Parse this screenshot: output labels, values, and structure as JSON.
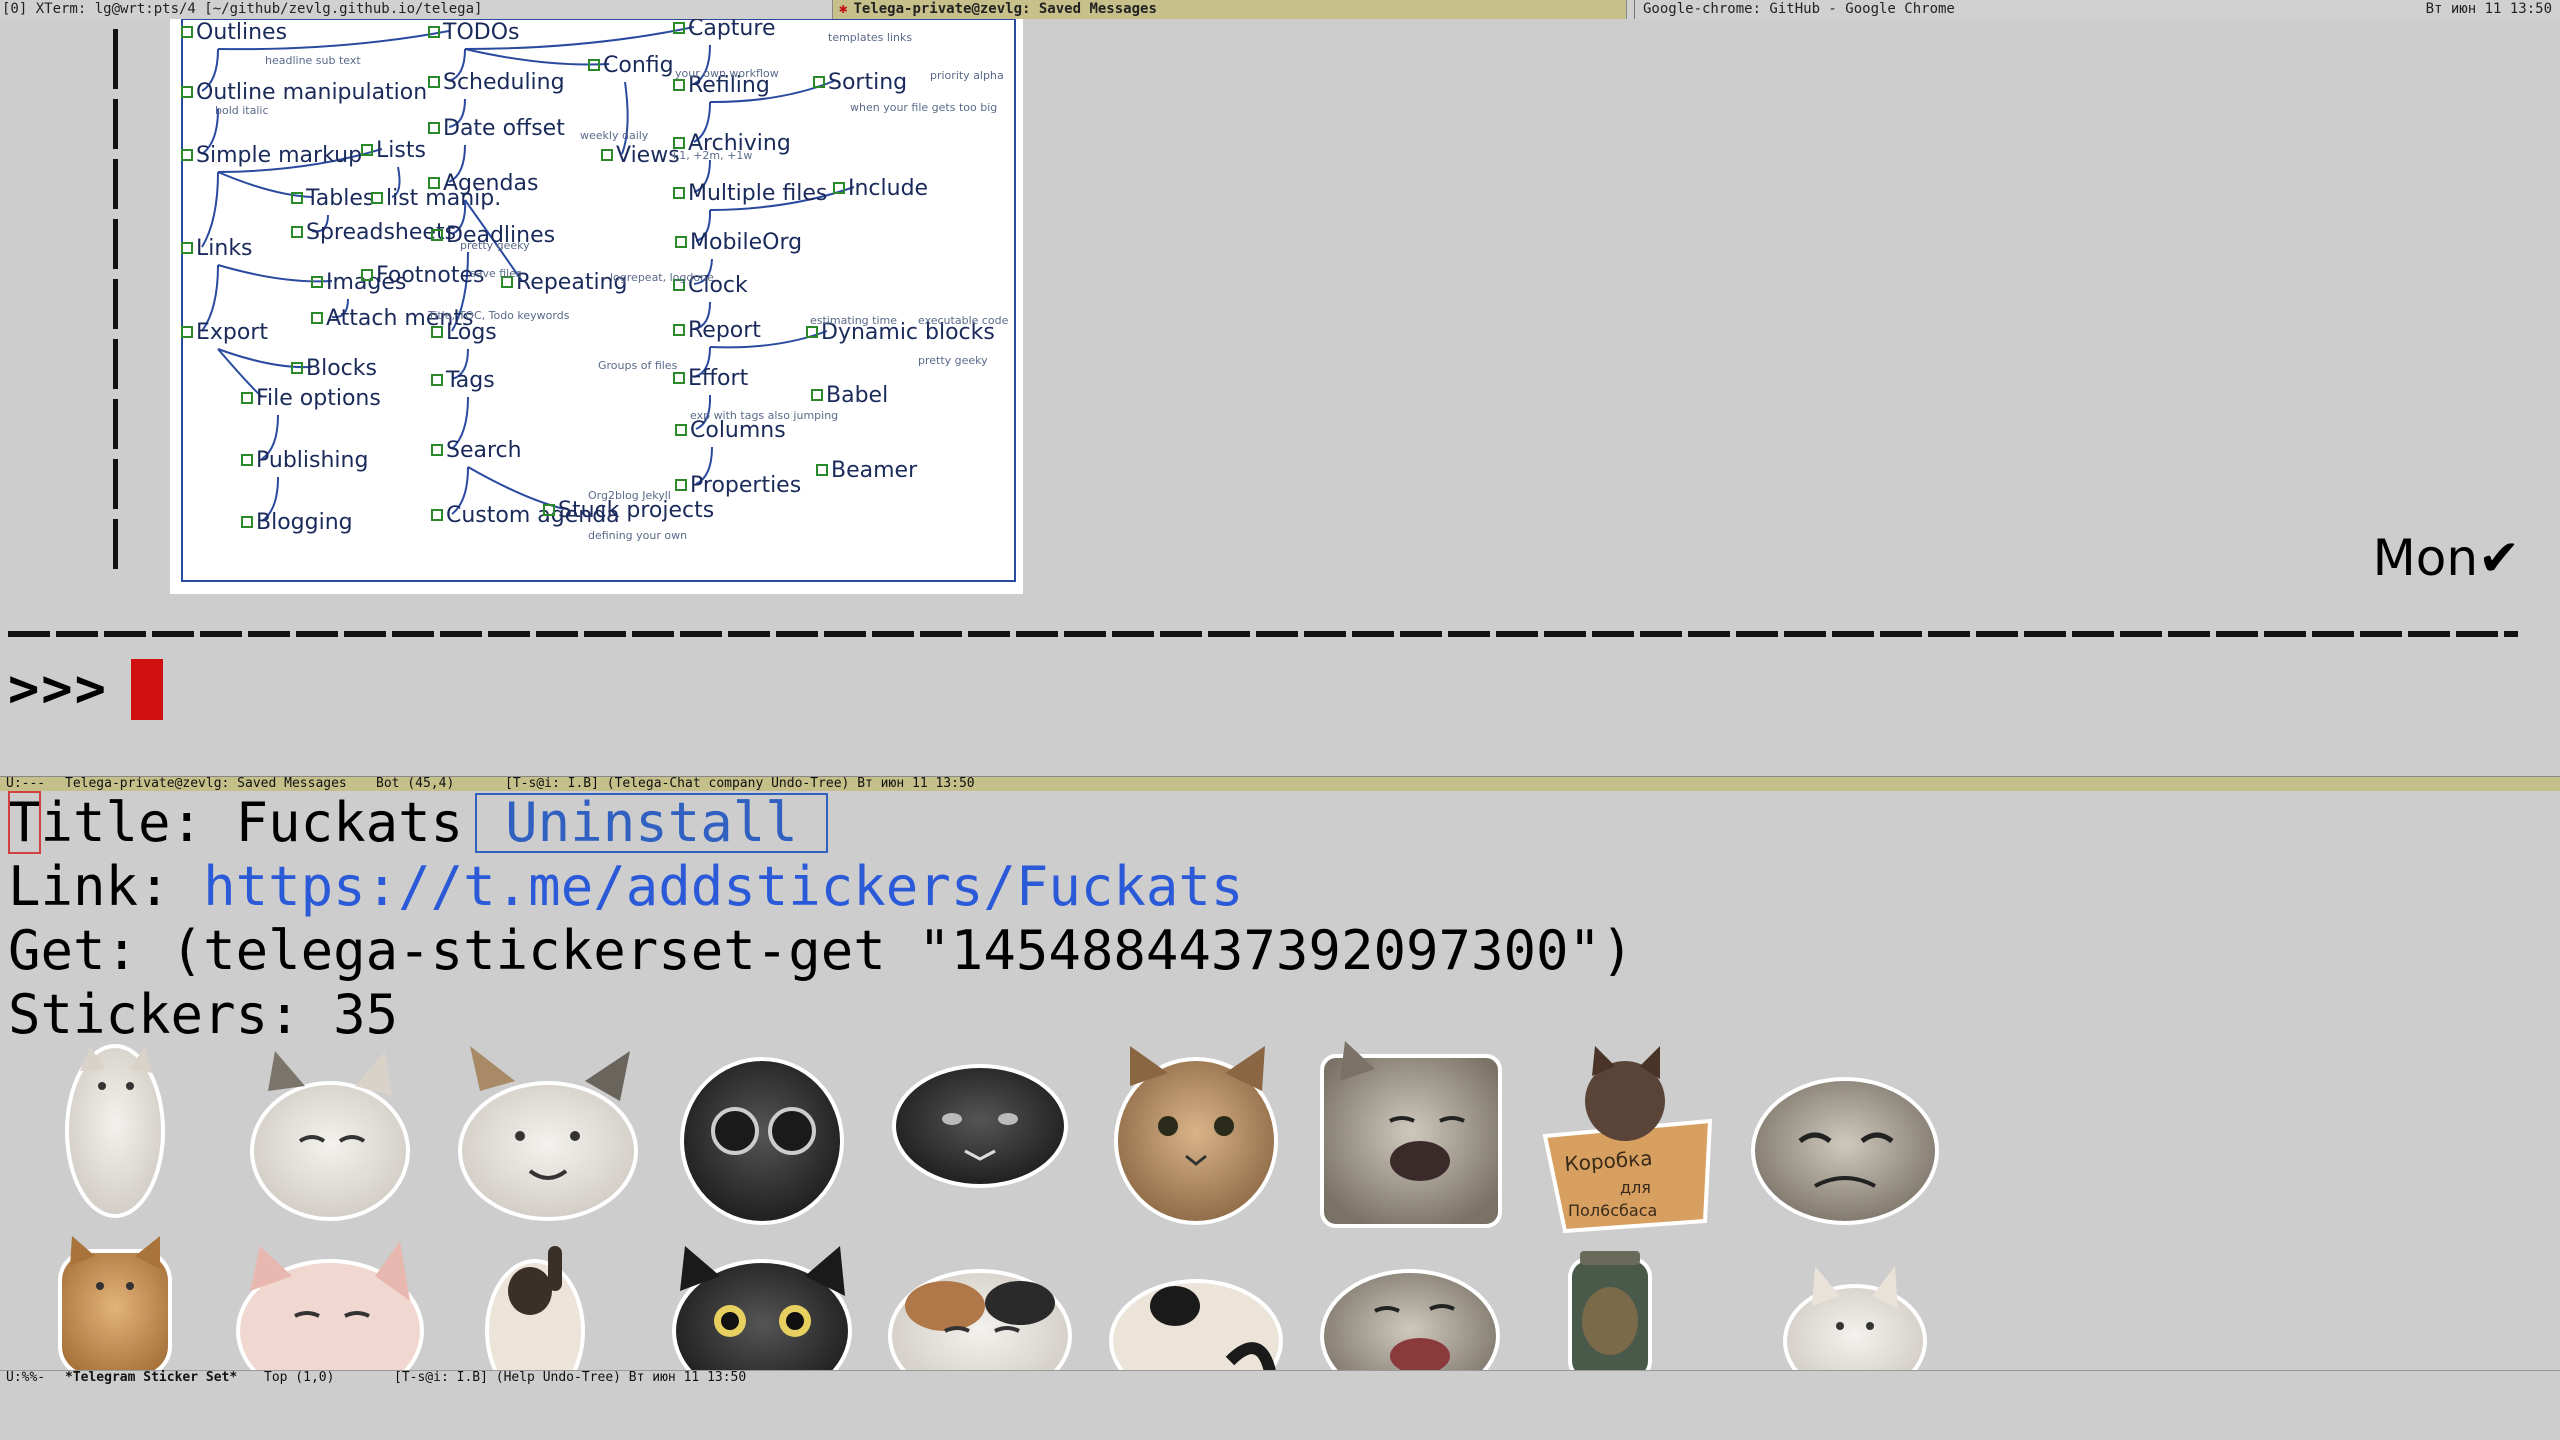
{
  "taskbar": {
    "xterm": "[0]  XTerm: lg@wrt:pts/4 [~/github/zevlg.github.io/telega]",
    "active_dot": "✱",
    "active_title": "Telega-private@zevlg: Saved Messages",
    "chrome": "Google-chrome: GitHub - Google Chrome",
    "clock": "Вт июн 11 13:50"
  },
  "mindmap": {
    "nodes": [
      "Outlines",
      "TODOs",
      "Capture",
      "Config",
      "Outline manipulation",
      "Scheduling",
      "Refiling",
      "Sorting",
      "Simple markup",
      "Lists",
      "Date offset",
      "Archiving",
      "Views",
      "Tables",
      "list manip.",
      "Agendas",
      "Multiple files",
      "Include",
      "Links",
      "Spreadsheets",
      "Deadlines",
      "MobileOrg",
      "Images",
      "Footnotes",
      "Repeating",
      "Clock",
      "Export",
      "Attach ments",
      "Logs",
      "Report",
      "Dynamic blocks",
      "Blocks",
      "Tags",
      "Effort",
      "File options",
      "Babel",
      "Columns",
      "Publishing",
      "Search",
      "Properties",
      "Beamer",
      "Blogging",
      "Custom agenda",
      "Stuck projects"
    ],
    "notes": [
      "templates links",
      "your own workflow",
      "priority alpha",
      "headline sub text",
      "bold italic",
      "when your file gets too big",
      "weekly daily",
      "pretty geeky",
      "save files",
      "logrepeat, logdone",
      "Title, TOC, Todo keywords",
      "estimating time",
      "executable code",
      "pretty geeky",
      "Groups of files",
      "exp with tags also jumping",
      "Org2blog Jekyll",
      "defining your own",
      "+1, +2m, +1w"
    ]
  },
  "upper": {
    "mon": "Mon",
    "checkmark": "✔",
    "prompt": ">>>"
  },
  "modeline1": {
    "state": "U:---",
    "buffer": "Telega-private@zevlg: Saved Messages",
    "position": "Bot (45,4)",
    "modes": "[T-s@i: I.B] (Telega-Chat company Undo-Tree) Вт июн 11 13:50"
  },
  "stickerset": {
    "title_first": "T",
    "title_label_rest": "itle: ",
    "title_value": "Fuckats",
    "uninstall": "Uninstall",
    "link_label": "Link:",
    "link_url": "https://t.me/addstickers/Fuckats",
    "get_line": "Get: (telega-stickerset-get \"1454884437392097300\")",
    "count_label": "Stickers:",
    "count": "35",
    "box_text_1": "Коробка",
    "box_text_2": "для",
    "box_text_3": "Пол6сбаса"
  },
  "modeline2": {
    "state": "U:%%-",
    "buffer": "*Telegram Sticker Set*",
    "position": "Top (1,0)",
    "modes": "[T-s@i: I.B] (Help Undo-Tree) Вт июн 11 13:50"
  },
  "colors": {
    "background": "#cdcdcd",
    "active_modeline": "#c5c08a",
    "link": "#2a5ad8",
    "cursor": "#d01010",
    "mindmap_line": "#2a4aa0",
    "checkbox": "#2a8a2a"
  }
}
